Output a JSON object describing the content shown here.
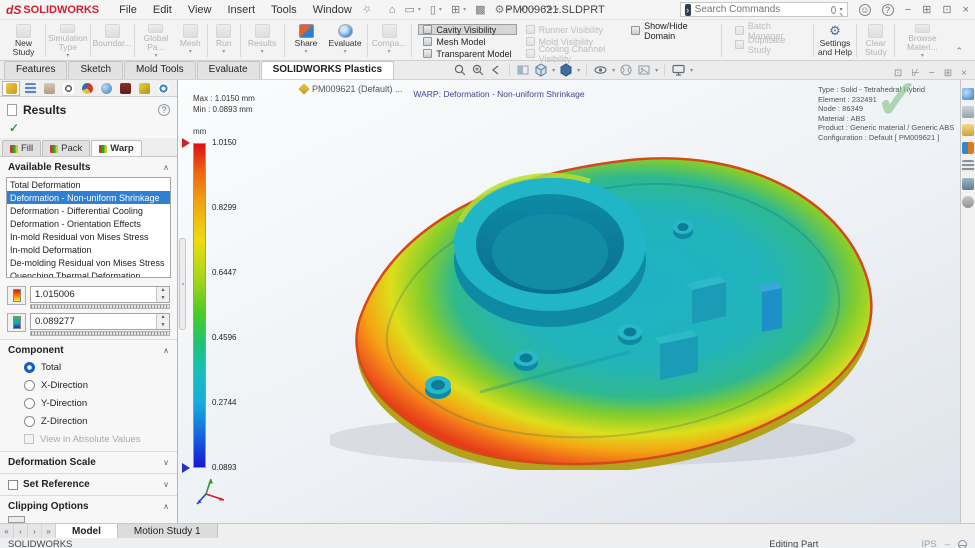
{
  "title_bar": {
    "logo_prefix": "dS",
    "logo_text": "SOLIDWORKS",
    "menus": [
      "File",
      "Edit",
      "View",
      "Insert",
      "Tools",
      "Window"
    ],
    "document_title": "PM009621.SLDPRT",
    "search_placeholder": "Search Commands"
  },
  "ribbon": {
    "study_buttons": [
      {
        "label": "New Study",
        "enabled": true
      },
      {
        "label": "Simulation Type",
        "enabled": false
      },
      {
        "label": "Boundar...",
        "enabled": false
      },
      {
        "label": "Global Pa...",
        "enabled": false
      },
      {
        "label": "Mesh",
        "enabled": false
      },
      {
        "label": "Run",
        "enabled": false
      },
      {
        "label": "Results",
        "enabled": false
      },
      {
        "label": "Share",
        "enabled": true
      },
      {
        "label": "Evaluate",
        "enabled": true
      },
      {
        "label": "Compa...",
        "enabled": false
      }
    ],
    "visibility_toggles": [
      {
        "label": "Cavity Visibility",
        "enabled": true,
        "pressed": true
      },
      {
        "label": "Mesh Model",
        "enabled": true,
        "pressed": false
      },
      {
        "label": "Transparent Model",
        "enabled": true,
        "pressed": false
      },
      {
        "label": "Runner Visibility",
        "enabled": false,
        "pressed": false
      },
      {
        "label": "Mold Visibility",
        "enabled": false,
        "pressed": false
      },
      {
        "label": "Cooling Channel Visibility",
        "enabled": false,
        "pressed": false
      }
    ],
    "domain_button": "Show/Hide Domain",
    "batch_manager": "Batch Manager",
    "duplicate_study": "Duplicate Study",
    "settings_help": "Settings and Help",
    "clear_study": "Clear Study",
    "browse_material": "Browse Materi..."
  },
  "command_tabs": {
    "items": [
      "Features",
      "Sketch",
      "Mold Tools",
      "Evaluate",
      "SOLIDWORKS Plastics"
    ],
    "active": "SOLIDWORKS Plastics"
  },
  "feature_tree_root": "PM009621 (Default) ...",
  "left_panel": {
    "title": "Results",
    "help_glyph": "?",
    "result_tabs": [
      "Fill",
      "Pack",
      "Warp"
    ],
    "active_result_tab": "Warp",
    "check_glyph": "✓",
    "available_results_label": "Available Results",
    "available_results": [
      "Total Deformation",
      "Deformation - Non-uniform Shrinkage",
      "Deformation - Differential Cooling",
      "Deformation - Orientation Effects",
      "In-mold Residual von Mises Stress",
      "In-mold Deformation",
      "De-molding Residual von Mises Stress",
      "Quenching Thermal Deformation"
    ],
    "selected_result": "Deformation - Non-uniform Shrinkage",
    "max_value": "1.015006",
    "min_value": "0.089277",
    "component": {
      "label": "Component",
      "options": [
        "Total",
        "X-Direction",
        "Y-Direction",
        "Z-Direction"
      ],
      "selected": "Total",
      "absolute_label": "View in Absolute Values"
    },
    "sections": {
      "deformation_scale": "Deformation Scale",
      "set_reference": "Set Reference",
      "clipping_options": "Clipping Options"
    }
  },
  "viewport": {
    "header": "WARP: Deformation - Non-uniform Shrinkage",
    "legend": {
      "max_label": "Max : 1.0150 mm",
      "min_label": "Min : 0.0893 mm",
      "unit": "mm",
      "ticks": [
        "1.0150",
        "0.8299",
        "0.6447",
        "0.4596",
        "0.2744",
        "0.0893"
      ]
    },
    "info_lines": [
      "Type : Solid - Tetrahedral Hybrid",
      "Element : 232491",
      "Node : 86349",
      "Material : ABS",
      "Product : Generic material / Generic ABS",
      "Configuration : Default [ PM009621 ]"
    ],
    "watermark_check": "✓"
  },
  "bottom": {
    "model_tabs": [
      "Model",
      "Motion Study 1"
    ],
    "active_tab": "Model",
    "status_left": "SOLIDWORKS",
    "status_editing": "Editing Part",
    "status_units": "IPS"
  },
  "icons": {
    "quick_access": [
      "home",
      "new-document",
      "open",
      "save",
      "print",
      "settings",
      "undo",
      "redo"
    ],
    "hud": [
      "zoom-fit",
      "zoom-area",
      "previous-view",
      "section-view",
      "view-orientation",
      "display-style",
      "hide-show-items",
      "edit-appearance",
      "apply-scene",
      "view-settings"
    ],
    "property_tabs": [
      "plastics-study",
      "feature-manager",
      "property-manager",
      "dimension",
      "results-pie",
      "display-manager",
      "simulation",
      "plastics-results",
      "sync"
    ],
    "task_pane": [
      "resources",
      "design-library",
      "file-explorer",
      "appearances",
      "custom-properties",
      "forum",
      "settings"
    ]
  },
  "colors": {
    "selection_blue": "#2f80d0",
    "legend_top_red": "#d91313",
    "legend_bottom_blue": "#1617d6",
    "check_green": "#2fa23c",
    "logo_red": "#cf2030"
  }
}
